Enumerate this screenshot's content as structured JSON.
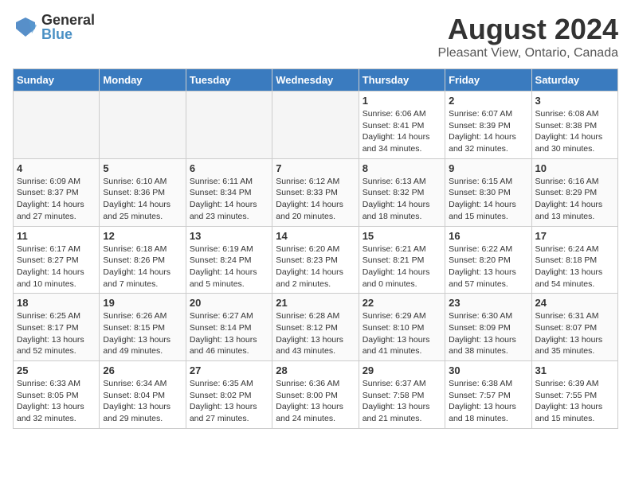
{
  "header": {
    "logo_line1": "General",
    "logo_line2": "Blue",
    "main_title": "August 2024",
    "sub_title": "Pleasant View, Ontario, Canada"
  },
  "days_of_week": [
    "Sunday",
    "Monday",
    "Tuesday",
    "Wednesday",
    "Thursday",
    "Friday",
    "Saturday"
  ],
  "weeks": [
    [
      {
        "day": "",
        "info": ""
      },
      {
        "day": "",
        "info": ""
      },
      {
        "day": "",
        "info": ""
      },
      {
        "day": "",
        "info": ""
      },
      {
        "day": "1",
        "info": "Sunrise: 6:06 AM\nSunset: 8:41 PM\nDaylight: 14 hours\nand 34 minutes."
      },
      {
        "day": "2",
        "info": "Sunrise: 6:07 AM\nSunset: 8:39 PM\nDaylight: 14 hours\nand 32 minutes."
      },
      {
        "day": "3",
        "info": "Sunrise: 6:08 AM\nSunset: 8:38 PM\nDaylight: 14 hours\nand 30 minutes."
      }
    ],
    [
      {
        "day": "4",
        "info": "Sunrise: 6:09 AM\nSunset: 8:37 PM\nDaylight: 14 hours\nand 27 minutes."
      },
      {
        "day": "5",
        "info": "Sunrise: 6:10 AM\nSunset: 8:36 PM\nDaylight: 14 hours\nand 25 minutes."
      },
      {
        "day": "6",
        "info": "Sunrise: 6:11 AM\nSunset: 8:34 PM\nDaylight: 14 hours\nand 23 minutes."
      },
      {
        "day": "7",
        "info": "Sunrise: 6:12 AM\nSunset: 8:33 PM\nDaylight: 14 hours\nand 20 minutes."
      },
      {
        "day": "8",
        "info": "Sunrise: 6:13 AM\nSunset: 8:32 PM\nDaylight: 14 hours\nand 18 minutes."
      },
      {
        "day": "9",
        "info": "Sunrise: 6:15 AM\nSunset: 8:30 PM\nDaylight: 14 hours\nand 15 minutes."
      },
      {
        "day": "10",
        "info": "Sunrise: 6:16 AM\nSunset: 8:29 PM\nDaylight: 14 hours\nand 13 minutes."
      }
    ],
    [
      {
        "day": "11",
        "info": "Sunrise: 6:17 AM\nSunset: 8:27 PM\nDaylight: 14 hours\nand 10 minutes."
      },
      {
        "day": "12",
        "info": "Sunrise: 6:18 AM\nSunset: 8:26 PM\nDaylight: 14 hours\nand 7 minutes."
      },
      {
        "day": "13",
        "info": "Sunrise: 6:19 AM\nSunset: 8:24 PM\nDaylight: 14 hours\nand 5 minutes."
      },
      {
        "day": "14",
        "info": "Sunrise: 6:20 AM\nSunset: 8:23 PM\nDaylight: 14 hours\nand 2 minutes."
      },
      {
        "day": "15",
        "info": "Sunrise: 6:21 AM\nSunset: 8:21 PM\nDaylight: 14 hours\nand 0 minutes."
      },
      {
        "day": "16",
        "info": "Sunrise: 6:22 AM\nSunset: 8:20 PM\nDaylight: 13 hours\nand 57 minutes."
      },
      {
        "day": "17",
        "info": "Sunrise: 6:24 AM\nSunset: 8:18 PM\nDaylight: 13 hours\nand 54 minutes."
      }
    ],
    [
      {
        "day": "18",
        "info": "Sunrise: 6:25 AM\nSunset: 8:17 PM\nDaylight: 13 hours\nand 52 minutes."
      },
      {
        "day": "19",
        "info": "Sunrise: 6:26 AM\nSunset: 8:15 PM\nDaylight: 13 hours\nand 49 minutes."
      },
      {
        "day": "20",
        "info": "Sunrise: 6:27 AM\nSunset: 8:14 PM\nDaylight: 13 hours\nand 46 minutes."
      },
      {
        "day": "21",
        "info": "Sunrise: 6:28 AM\nSunset: 8:12 PM\nDaylight: 13 hours\nand 43 minutes."
      },
      {
        "day": "22",
        "info": "Sunrise: 6:29 AM\nSunset: 8:10 PM\nDaylight: 13 hours\nand 41 minutes."
      },
      {
        "day": "23",
        "info": "Sunrise: 6:30 AM\nSunset: 8:09 PM\nDaylight: 13 hours\nand 38 minutes."
      },
      {
        "day": "24",
        "info": "Sunrise: 6:31 AM\nSunset: 8:07 PM\nDaylight: 13 hours\nand 35 minutes."
      }
    ],
    [
      {
        "day": "25",
        "info": "Sunrise: 6:33 AM\nSunset: 8:05 PM\nDaylight: 13 hours\nand 32 minutes."
      },
      {
        "day": "26",
        "info": "Sunrise: 6:34 AM\nSunset: 8:04 PM\nDaylight: 13 hours\nand 29 minutes."
      },
      {
        "day": "27",
        "info": "Sunrise: 6:35 AM\nSunset: 8:02 PM\nDaylight: 13 hours\nand 27 minutes."
      },
      {
        "day": "28",
        "info": "Sunrise: 6:36 AM\nSunset: 8:00 PM\nDaylight: 13 hours\nand 24 minutes."
      },
      {
        "day": "29",
        "info": "Sunrise: 6:37 AM\nSunset: 7:58 PM\nDaylight: 13 hours\nand 21 minutes."
      },
      {
        "day": "30",
        "info": "Sunrise: 6:38 AM\nSunset: 7:57 PM\nDaylight: 13 hours\nand 18 minutes."
      },
      {
        "day": "31",
        "info": "Sunrise: 6:39 AM\nSunset: 7:55 PM\nDaylight: 13 hours\nand 15 minutes."
      }
    ]
  ]
}
